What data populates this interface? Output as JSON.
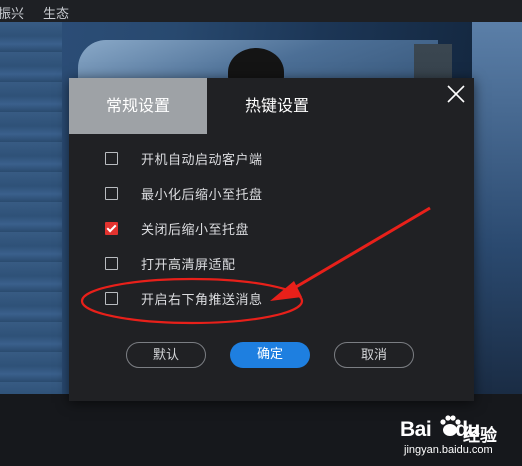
{
  "app": {
    "nav_items": [
      "振兴",
      "生态"
    ]
  },
  "dialog": {
    "tabs": [
      {
        "label": "常规设置",
        "active": true
      },
      {
        "label": "热键设置",
        "active": false
      }
    ],
    "options": [
      {
        "label": "开机自动启动客户端",
        "checked": false
      },
      {
        "label": "最小化后缩小至托盘",
        "checked": false
      },
      {
        "label": "关闭后缩小至托盘",
        "checked": true
      },
      {
        "label": "打开高清屏适配",
        "checked": false
      },
      {
        "label": "开启右下角推送消息",
        "checked": false
      }
    ],
    "buttons": {
      "default_label": "默认",
      "ok_label": "确定",
      "cancel_label": "取消"
    }
  },
  "colors": {
    "accent_blue": "#1e7fe0",
    "check_red": "#e3332f",
    "annotation_red": "#e8201a"
  },
  "watermark": {
    "brand": "Bai",
    "brand_suffix": "du",
    "cn": "经验",
    "url": "jingyan.baidu.com"
  }
}
